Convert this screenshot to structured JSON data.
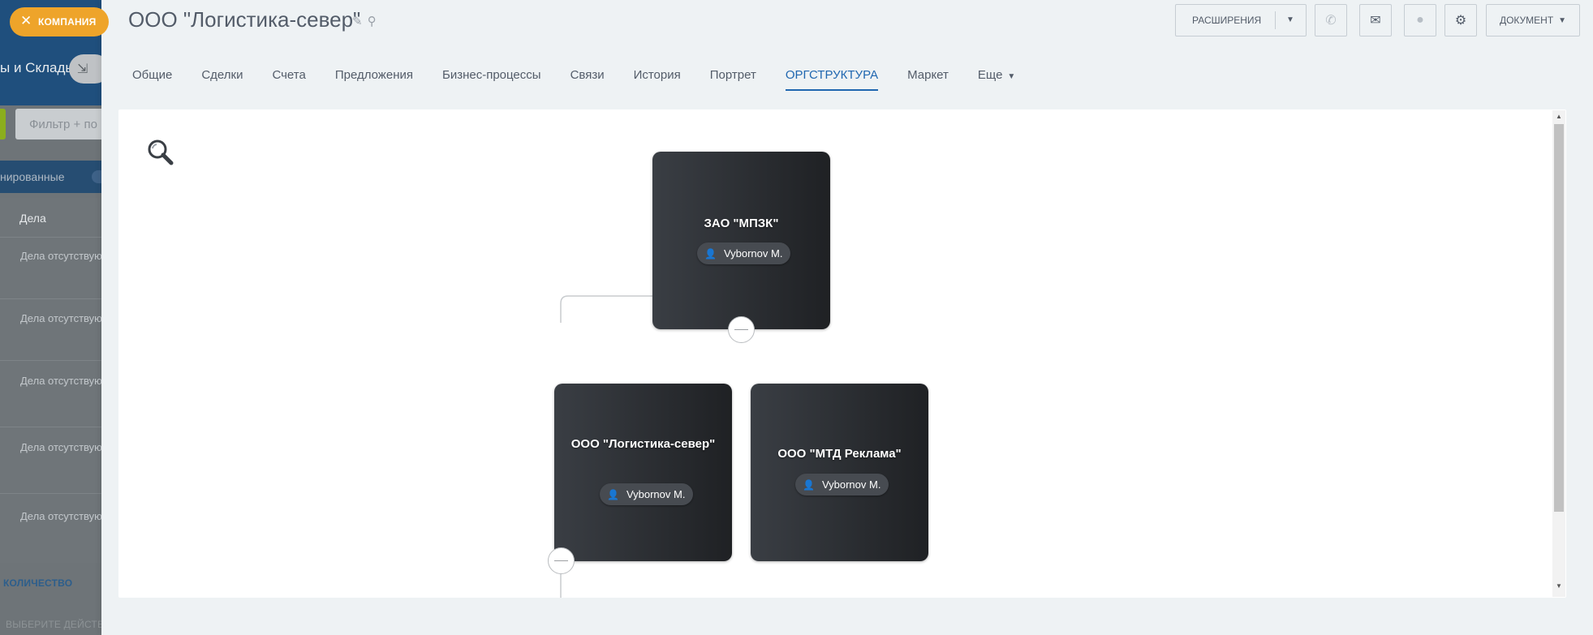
{
  "background": {
    "title_fragment": "ы и Склады",
    "filter_placeholder": "Фильтр + по",
    "presets_fragment": "нированные",
    "column_header": "Дела",
    "rows": [
      "Дела отсутствуют",
      "Дела отсутствуют",
      "Дела отсутствуют",
      "Дела отсутствуют",
      "Дела отсутствуют"
    ],
    "count_label": "КОЛИЧЕСТВО",
    "action_label": "ВЫБЕРИТЕ ДЕЙСТВИЕ"
  },
  "entity_label": {
    "text": "КОМПАНИЯ",
    "close_icon": "close-icon"
  },
  "header": {
    "title": "ООО \"Логистика-север\"",
    "edit_icon": "pencil-icon",
    "link_icon": "link-icon"
  },
  "toolbar": {
    "extensions_label": "РАСШИРЕНИЯ",
    "document_label": "ДОКУМЕНТ",
    "phone_icon": "phone-icon",
    "mail_icon": "mail-icon",
    "chat_icon": "chat-icon",
    "settings_icon": "gear-icon"
  },
  "tabs": [
    {
      "label": "Общие",
      "active": false
    },
    {
      "label": "Сделки",
      "active": false
    },
    {
      "label": "Счета",
      "active": false
    },
    {
      "label": "Предложения",
      "active": false
    },
    {
      "label": "Бизнес-процессы",
      "active": false
    },
    {
      "label": "Связи",
      "active": false
    },
    {
      "label": "История",
      "active": false
    },
    {
      "label": "Портрет",
      "active": false
    },
    {
      "label": "ОРГСТРУКТУРА",
      "active": true
    },
    {
      "label": "Маркет",
      "active": false
    },
    {
      "label": "Еще",
      "active": false
    }
  ],
  "orgchart": {
    "zoom_icon": "magnifier-icon",
    "root": {
      "name": "ЗАО \"МПЗК\"",
      "person": "Vybornov M."
    },
    "children": [
      {
        "name": "ООО \"Логистика-север\"",
        "person": "Vybornov M."
      },
      {
        "name": "ООО \"МТД Реклама\"",
        "person": "Vybornov M."
      }
    ]
  },
  "colors": {
    "accent": "#2067b0",
    "entity_label": "#eea42a",
    "card_dark": "#2b2e32"
  }
}
